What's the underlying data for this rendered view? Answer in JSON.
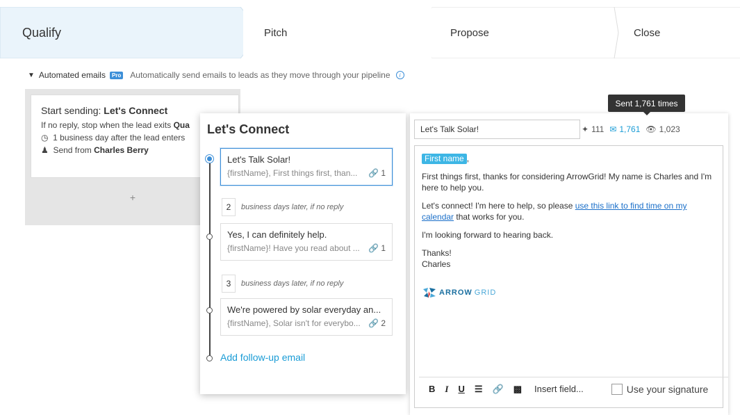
{
  "pipeline": {
    "stages": [
      {
        "label": "Qualify"
      },
      {
        "label": "Pitch"
      },
      {
        "label": "Propose"
      },
      {
        "label": "Close"
      }
    ]
  },
  "automated": {
    "label": "Automated emails",
    "badge": "Pro",
    "description": "Automatically send emails to leads as they move through your pipeline",
    "info_icon": "i"
  },
  "sequence_card": {
    "title_prefix": "Start sending: ",
    "title_name": "Let's Connect",
    "stop_rule_prefix": "If no reply, stop when the lead exits ",
    "stop_rule_stage": "Qua",
    "timing": "1 business day after the lead enters",
    "send_from_prefix": "Send from ",
    "send_from_name": "Charles Berry",
    "add_symbol": "+"
  },
  "popup": {
    "title": "Let's Connect",
    "emails": [
      {
        "subject": "Let's Talk Solar!",
        "preview": "{firstName}, First things first, than...",
        "attachments": "1"
      },
      {
        "subject": "Yes, I can definitely help.",
        "preview": "{firstName}! Have you read about ...",
        "attachments": "1"
      },
      {
        "subject": "We're powered by solar everyday an...",
        "preview": "{firstName}, Solar isn't for everybo...",
        "attachments": "2"
      }
    ],
    "delays": [
      {
        "days": "2",
        "text": "business days later, if no reply"
      },
      {
        "days": "3",
        "text": "business days later, if no reply"
      }
    ],
    "add_followup": "Add follow-up email"
  },
  "editor": {
    "subject": "Let's Talk Solar!",
    "stats": {
      "clicks": "111",
      "sent": "1,761",
      "views": "1,023"
    },
    "tooltip": "Sent 1,761 times",
    "body": {
      "merge_field": "First name",
      "greeting_suffix": ",",
      "para1": "First things first, thanks for considering ArrowGrid! My name is Charles and I'm here to help you.",
      "para2_prefix": "Let's connect! I'm here to help, so please ",
      "para2_link": "use this link to find time on my calendar",
      "para2_suffix": " that works for you.",
      "para3": "I'm looking forward to hearing back.",
      "signoff1": "Thanks!",
      "signoff2": "Charles",
      "logo_arrow": "ARROW",
      "logo_grid": "GRID"
    },
    "toolbar": {
      "bold": "B",
      "italic": "I",
      "underline": "U",
      "insert_field": "Insert field...",
      "signature_label": "Use your signature"
    }
  },
  "colors": {
    "accent": "#1a9cd6",
    "stage_active_bg": "#eaf4fb",
    "chip": "#3db6e5"
  }
}
